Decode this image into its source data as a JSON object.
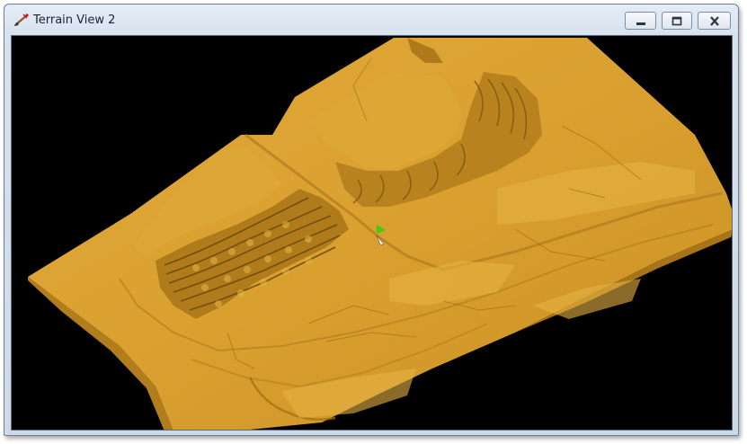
{
  "window": {
    "title": "Terrain View 2",
    "title_icon": "paintbrush-icon",
    "controls": {
      "minimize": "minimize-icon",
      "maximize": "maximize-icon",
      "close": "close-icon"
    }
  },
  "viewport": {
    "background_color": "#000000",
    "terrain_color": "#d9a030",
    "cursor_marker_color": "#3ecc18"
  }
}
